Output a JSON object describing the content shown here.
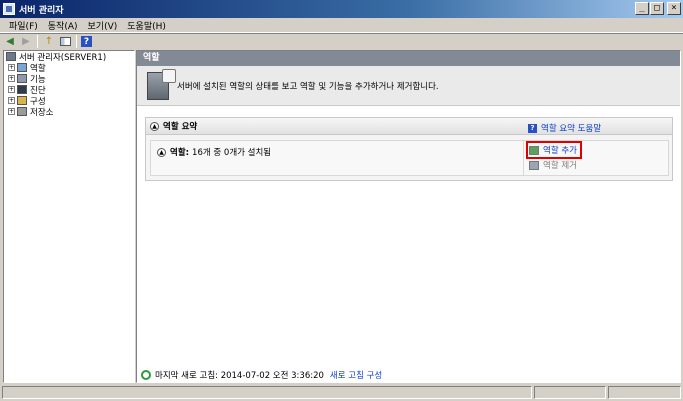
{
  "window": {
    "title": "서버 관리자"
  },
  "window_controls": {
    "minimize": "_",
    "maximize": "□",
    "close": "×"
  },
  "menu": {
    "items": [
      "파일(F)",
      "동작(A)",
      "보기(V)",
      "도움말(H)"
    ]
  },
  "toolbar": {
    "glyphs": {
      "back": "◀",
      "forward": "▶",
      "up": "↑",
      "help": "?"
    }
  },
  "tree": {
    "root": "서버 관리자(SERVER1)",
    "children": [
      "역할",
      "기능",
      "진단",
      "구성",
      "저장소"
    ]
  },
  "main": {
    "header": "역할",
    "intro": "서버에 설치된 역할의 상태를 보고 역할 및 기능을 추가하거나 제거합니다.",
    "section": {
      "title": "역할 요약",
      "help_link": "역할 요약 도움말",
      "roles_label": "역할:",
      "roles_count": "16개 중 0개가 설치됨",
      "actions": {
        "add": "역할 추가",
        "remove": "역할 제거"
      }
    },
    "refresh": {
      "last": "마지막 새로 고침: 2014-07-02 오전 3:36:20",
      "configure": "새로 고침 구성"
    }
  },
  "colors": {
    "link": "#0b3fc9",
    "highlight": "#e00000",
    "header_bg": "#828a96",
    "titlebar": "#0a246a"
  }
}
